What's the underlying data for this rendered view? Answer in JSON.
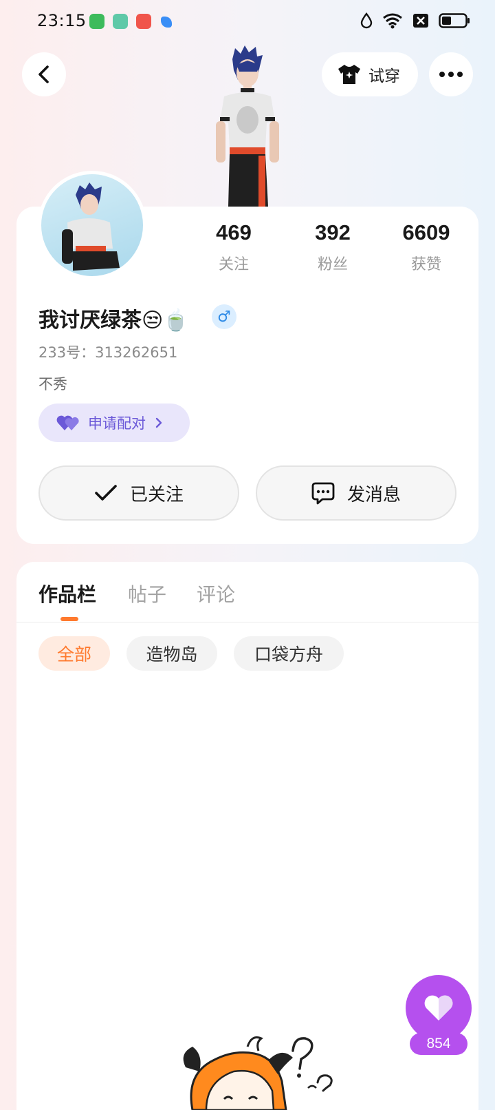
{
  "status_bar": {
    "time": "23:15"
  },
  "header": {
    "try_on_label": "试穿"
  },
  "profile": {
    "stats": [
      {
        "value": "469",
        "label": "关注"
      },
      {
        "value": "392",
        "label": "粉丝"
      },
      {
        "value": "6609",
        "label": "获赞"
      }
    ],
    "username": "我讨厌绿茶😒🍵",
    "gender_symbol": "♂",
    "uid": "233号：313262651",
    "bio": "不秀",
    "pair_button": "申请配对",
    "follow_button": "已关注",
    "message_button": "发消息"
  },
  "tabs": [
    {
      "label": "作品栏",
      "active": true
    },
    {
      "label": "帖子",
      "active": false
    },
    {
      "label": "评论",
      "active": false
    }
  ],
  "filters": [
    {
      "label": "全部",
      "active": true
    },
    {
      "label": "造物岛",
      "active": false
    },
    {
      "label": "口袋方舟",
      "active": false
    }
  ],
  "like_fab": {
    "count": "854"
  },
  "colors": {
    "accent_orange": "#ff7a2e",
    "pair_purple": "#6b59d8",
    "like_purple": "#b550ee",
    "gender_blue": "#2f8be6"
  }
}
